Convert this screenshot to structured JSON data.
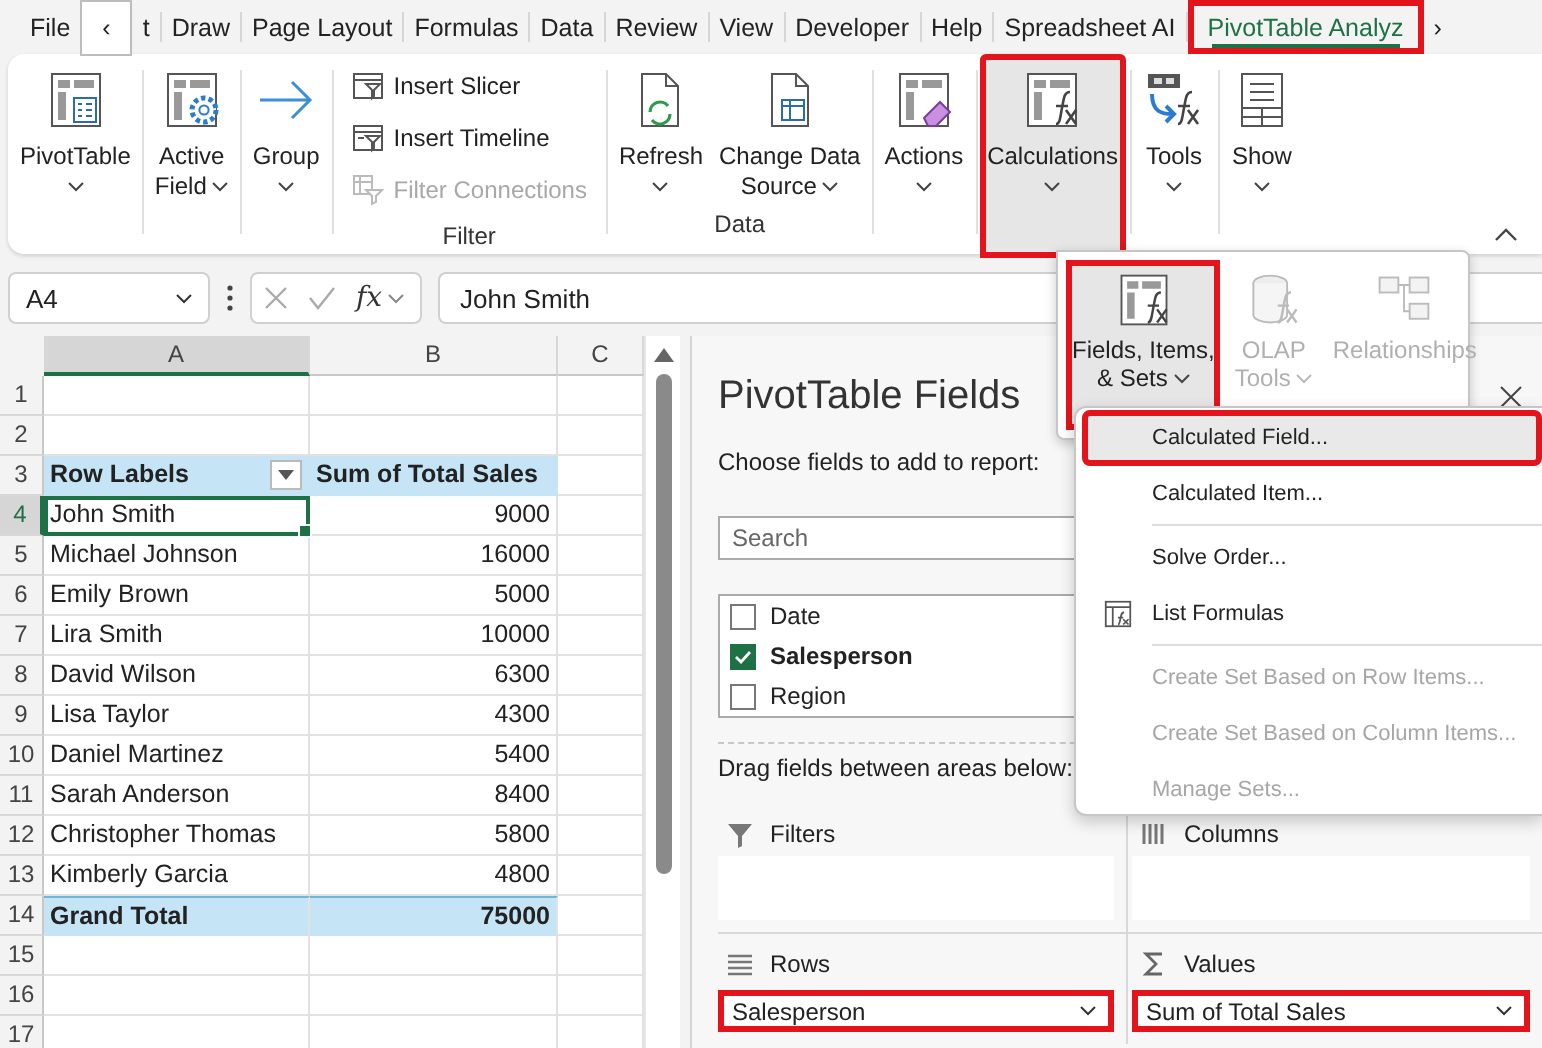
{
  "tabs": [
    {
      "label": "File",
      "kind": "tab",
      "selected": false,
      "annotated": false
    },
    {
      "label": "‹",
      "kind": "scroll",
      "hovered": true
    },
    {
      "label": "t",
      "kind": "tab",
      "selected": false,
      "annotated": false
    },
    {
      "label": "Draw",
      "kind": "tab",
      "selected": false,
      "annotated": false
    },
    {
      "label": "Page Layout",
      "kind": "tab",
      "selected": false,
      "annotated": false
    },
    {
      "label": "Formulas",
      "kind": "tab",
      "selected": false,
      "annotated": false
    },
    {
      "label": "Data",
      "kind": "tab",
      "selected": false,
      "annotated": false
    },
    {
      "label": "Review",
      "kind": "tab",
      "selected": false,
      "annotated": false
    },
    {
      "label": "View",
      "kind": "tab",
      "selected": false,
      "annotated": false
    },
    {
      "label": "Developer",
      "kind": "tab",
      "selected": false,
      "annotated": false
    },
    {
      "label": "Help",
      "kind": "tab",
      "selected": false,
      "annotated": false
    },
    {
      "label": "Spreadsheet AI",
      "kind": "tab",
      "selected": false,
      "annotated": false
    },
    {
      "label": "PivotTable Analyz",
      "kind": "tab",
      "selected": true,
      "annotated": true
    },
    {
      "label": "›",
      "kind": "scroll",
      "hovered": false
    }
  ],
  "ribbon": {
    "groups": [
      {
        "items": [
          {
            "kind": "large",
            "label": "PivotTable",
            "dropdown": true,
            "pressed": false,
            "annotated": false
          }
        ]
      },
      {
        "items": [
          {
            "kind": "large",
            "label": "Active\nField",
            "dropdown": true,
            "pressed": false,
            "annotated": false
          }
        ]
      },
      {
        "items": [
          {
            "kind": "large",
            "label": "Group",
            "dropdown": true,
            "pressed": false,
            "annotated": false
          }
        ]
      },
      {
        "label": "Filter",
        "items": [
          {
            "kind": "small",
            "label": "Insert Slicer",
            "disabled": false
          },
          {
            "kind": "small",
            "label": "Insert Timeline",
            "disabled": false
          },
          {
            "kind": "small",
            "label": "Filter Connections",
            "disabled": true
          }
        ]
      },
      {
        "label": "Data",
        "items": [
          {
            "kind": "large",
            "label": "Refresh",
            "dropdown": true,
            "pressed": false,
            "annotated": false
          },
          {
            "kind": "large",
            "label": "Change Data\nSource",
            "dropdown": true,
            "pressed": false,
            "annotated": false
          }
        ]
      },
      {
        "items": [
          {
            "kind": "large",
            "label": "Actions",
            "dropdown": true,
            "pressed": false,
            "annotated": false
          }
        ]
      },
      {
        "items": [
          {
            "kind": "large",
            "label": "Calculations",
            "dropdown": true,
            "pressed": true,
            "annotated": true
          }
        ]
      },
      {
        "items": [
          {
            "kind": "large",
            "label": "Tools",
            "dropdown": true,
            "pressed": false,
            "annotated": false
          }
        ]
      },
      {
        "items": [
          {
            "kind": "large",
            "label": "Show",
            "dropdown": true,
            "pressed": false,
            "annotated": false
          }
        ]
      }
    ]
  },
  "formula_bar": {
    "name_box": "A4",
    "function_label": "fx",
    "formula": "John Smith"
  },
  "sheet": {
    "columns": [
      {
        "label": "A",
        "selected": true
      },
      {
        "label": "B",
        "selected": false
      },
      {
        "label": "C",
        "selected": false
      }
    ],
    "rows": [
      {
        "number": "1",
        "kind": "empty",
        "selected": false
      },
      {
        "number": "2",
        "kind": "empty",
        "selected": false
      },
      {
        "number": "3",
        "kind": "header",
        "selected": false,
        "cells": [
          "Row Labels",
          "Sum of Total Sales"
        ]
      },
      {
        "number": "4",
        "kind": "item",
        "selected": true,
        "cells": [
          "John Smith",
          "9000"
        ]
      },
      {
        "number": "5",
        "kind": "item",
        "selected": false,
        "cells": [
          "Michael Johnson",
          "16000"
        ]
      },
      {
        "number": "6",
        "kind": "item",
        "selected": false,
        "cells": [
          "Emily Brown",
          "5000"
        ]
      },
      {
        "number": "7",
        "kind": "item",
        "selected": false,
        "cells": [
          "Lira Smith",
          "10000"
        ]
      },
      {
        "number": "8",
        "kind": "item",
        "selected": false,
        "cells": [
          "David Wilson",
          "6300"
        ]
      },
      {
        "number": "9",
        "kind": "item",
        "selected": false,
        "cells": [
          "Lisa Taylor",
          "4300"
        ]
      },
      {
        "number": "10",
        "kind": "item",
        "selected": false,
        "cells": [
          "Daniel Martinez",
          "5400"
        ]
      },
      {
        "number": "11",
        "kind": "item",
        "selected": false,
        "cells": [
          "Sarah Anderson",
          "8400"
        ]
      },
      {
        "number": "12",
        "kind": "item",
        "selected": false,
        "cells": [
          "Christopher Thomas",
          "5800"
        ]
      },
      {
        "number": "13",
        "kind": "item",
        "selected": false,
        "cells": [
          "Kimberly Garcia",
          "4800"
        ]
      },
      {
        "number": "14",
        "kind": "total",
        "selected": false,
        "cells": [
          "Grand Total",
          "75000"
        ]
      },
      {
        "number": "15",
        "kind": "empty",
        "selected": false
      },
      {
        "number": "16",
        "kind": "empty",
        "selected": false
      },
      {
        "number": "17",
        "kind": "empty",
        "selected": false
      }
    ]
  },
  "pane": {
    "title": "PivotTable Fields",
    "prompt": "Choose fields to add to report:",
    "search_placeholder": "Search",
    "fields": [
      {
        "label": "Date",
        "checked": false
      },
      {
        "label": "Salesperson",
        "checked": true
      },
      {
        "label": "Region",
        "checked": false
      }
    ],
    "drag_prompt": "Drag fields between areas below:",
    "areas": [
      {
        "label": "Filters"
      },
      {
        "label": "Columns"
      },
      {
        "label": "Rows",
        "field": {
          "label": "Salesperson",
          "annotated": true
        }
      },
      {
        "label": "Values",
        "field": {
          "label": "Sum of Total Sales",
          "annotated": true
        }
      }
    ]
  },
  "calc_popup": {
    "buttons": [
      {
        "label": "Fields, Items,\n& Sets",
        "dropdown": true,
        "disabled": false,
        "pressed": true,
        "annotated": true
      },
      {
        "label": "OLAP\nTools",
        "dropdown": true,
        "disabled": true,
        "pressed": false,
        "annotated": false
      },
      {
        "label": "Relationships",
        "dropdown": false,
        "disabled": true,
        "pressed": false,
        "annotated": false
      }
    ]
  },
  "menu": {
    "items": [
      {
        "kind": "item",
        "label": "Calculated Field...",
        "disabled": false,
        "selected": true,
        "annotated": true
      },
      {
        "kind": "item",
        "label": "Calculated Item...",
        "disabled": false,
        "selected": false,
        "annotated": false
      },
      {
        "kind": "separator"
      },
      {
        "kind": "item",
        "label": "Solve Order...",
        "disabled": false,
        "selected": false,
        "annotated": false
      },
      {
        "kind": "item",
        "label": "List Formulas",
        "disabled": false,
        "selected": false,
        "annotated": false
      },
      {
        "kind": "separator"
      },
      {
        "kind": "item",
        "label": "Create Set Based on Row Items...",
        "disabled": true,
        "selected": false,
        "annotated": false
      },
      {
        "kind": "item",
        "label": "Create Set Based on Column Items...",
        "disabled": true,
        "selected": false,
        "annotated": false
      },
      {
        "kind": "item",
        "label": "Manage Sets...",
        "disabled": true,
        "selected": false,
        "annotated": false
      }
    ]
  }
}
